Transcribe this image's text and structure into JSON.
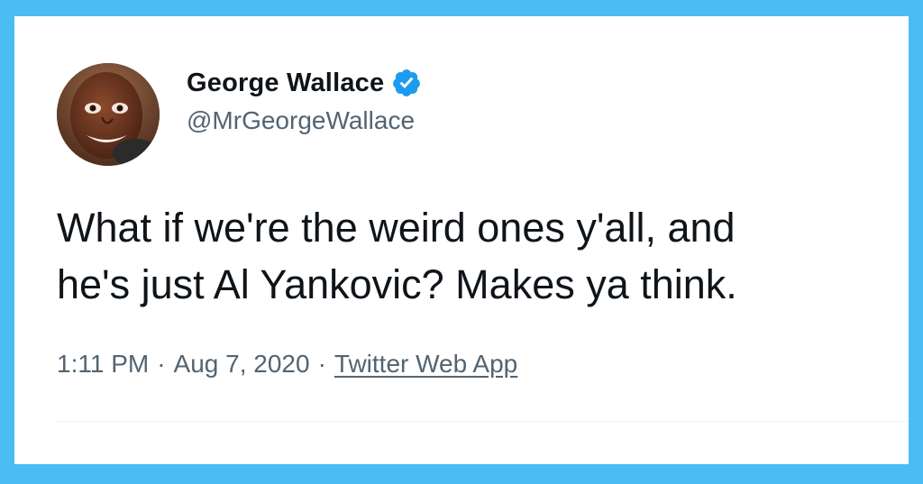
{
  "author": {
    "name": "George Wallace",
    "handle": "@MrGeorgeWallace",
    "verified_icon": "verified-badge-icon",
    "verified_color": "#1d9bf0"
  },
  "tweet": {
    "lines": [
      "What if we're the weird ones y'all, and",
      "he's just Al Yankovic? Makes ya think."
    ]
  },
  "meta": {
    "time": "1:11 PM",
    "separator": "·",
    "date": "Aug 7, 2020",
    "source": "Twitter Web App"
  },
  "colors": {
    "background": "#4cbcf4",
    "card": "#ffffff",
    "text_primary": "#0f1419",
    "text_secondary": "#536471"
  }
}
